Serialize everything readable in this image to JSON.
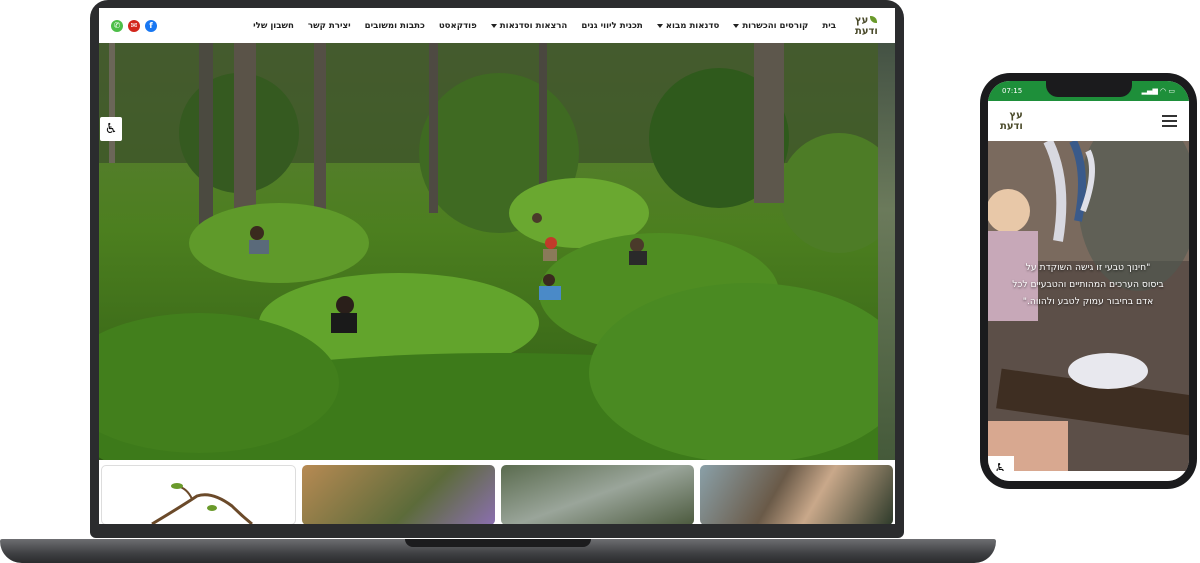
{
  "site": {
    "brand_line1": "עץ",
    "brand_line2": "ודעת",
    "nav": [
      {
        "label": "בית",
        "dropdown": false
      },
      {
        "label": "קורסים והכשרות",
        "dropdown": true
      },
      {
        "label": "סדנאות מבוא",
        "dropdown": true
      },
      {
        "label": "תכנית ליווי גנים",
        "dropdown": false
      },
      {
        "label": "הרצאות וסדנאות",
        "dropdown": true
      },
      {
        "label": "פודקאסט",
        "dropdown": false
      },
      {
        "label": "כתבות ומשובים",
        "dropdown": false
      },
      {
        "label": "יצירת קשר",
        "dropdown": false
      },
      {
        "label": "חשבון שלי",
        "dropdown": false
      }
    ],
    "socials": [
      {
        "name": "whatsapp-icon",
        "glyph": "✆"
      },
      {
        "name": "email-icon",
        "glyph": "✉"
      },
      {
        "name": "facebook-icon",
        "glyph": "f"
      }
    ],
    "accessibility_glyph": "♿"
  },
  "phone": {
    "time": "07:15",
    "status_right": "▂▄▆ ◠ ▭",
    "brand_line1": "עץ",
    "brand_line2": "ודעת",
    "quote_line1": "\"חינוך טבעי זו גישה השוקדת על",
    "quote_line2": "ביסוס הערכים המהותיים והטבעיים לכל",
    "quote_line3": "אדם בחיבור עמוק לטבע ולהווה.\"",
    "accessibility_glyph": "♿"
  },
  "colors": {
    "status_bar": "#1e8f3a",
    "brand_leaf": "#6a9a2b",
    "whatsapp": "#4dbe48",
    "email": "#d2261c",
    "facebook": "#1877f2"
  }
}
